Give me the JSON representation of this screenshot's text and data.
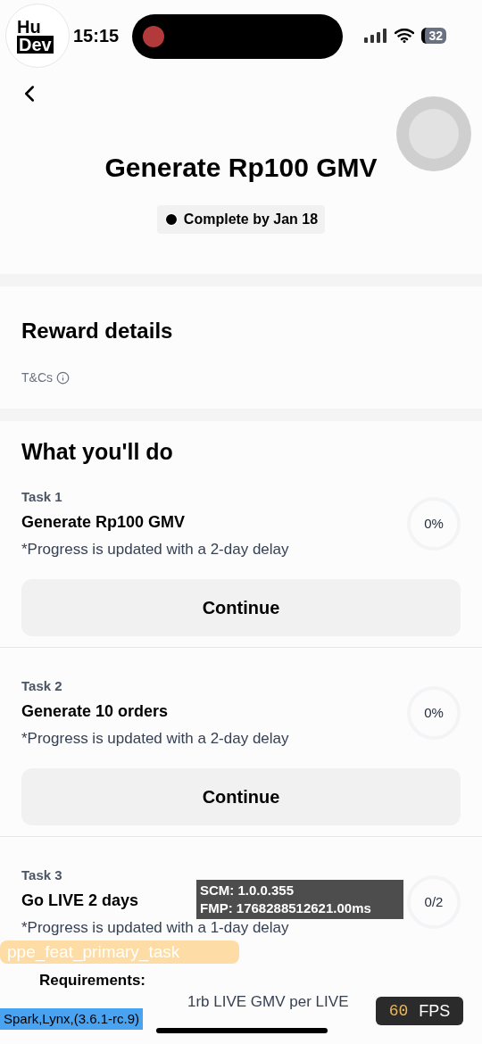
{
  "status_bar": {
    "time": "15:15",
    "battery": "32"
  },
  "logo": {
    "line1": "Hu",
    "line2": "Dev"
  },
  "header": {
    "title": "Generate Rp100 GMV",
    "deadline": "Complete by Jan 18"
  },
  "reward": {
    "title": "Reward details",
    "terms": "T&Cs"
  },
  "tasks_section": {
    "title": "What you'll do"
  },
  "tasks": [
    {
      "label": "Task 1",
      "title": "Generate Rp100 GMV",
      "note": "*Progress is updated with a 2-day delay",
      "progress": "0%",
      "button": "Continue"
    },
    {
      "label": "Task 2",
      "title": "Generate 10 orders",
      "note": "*Progress is updated with a 2-day delay",
      "progress": "0%",
      "button": "Continue"
    },
    {
      "label": "Task 3",
      "title": "Go LIVE 2 days",
      "note": "*Progress is updated with a 1-day delay",
      "progress": "0/2",
      "requirements_title": "Requirements:",
      "requirement": "1rb LIVE GMV per LIVE"
    }
  ],
  "debug": {
    "scm": "SCM: 1.0.0.355",
    "fmp": "FMP: 1768288512621.00ms",
    "branch": "ppe_feat_primary_task",
    "engine": "Spark,Lynx,(3.6.1-rc.9)",
    "fps_value": "60",
    "fps_label": "FPS"
  }
}
